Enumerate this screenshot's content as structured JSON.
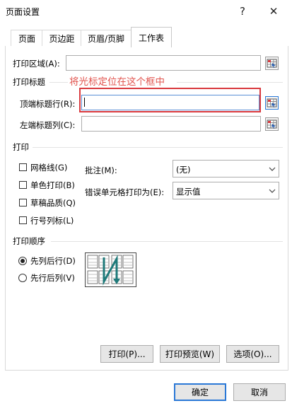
{
  "window": {
    "title": "页面设置",
    "help_icon": "?",
    "close_icon": "✕"
  },
  "tabs": [
    "页面",
    "页边距",
    "页眉/页脚",
    "工作表"
  ],
  "print_area": {
    "label": "打印区域(A):",
    "value": ""
  },
  "print_titles": {
    "section": "打印标题",
    "rows_label": "顶端标题行(R):",
    "rows_value": "",
    "cols_label": "左端标题列(C):",
    "cols_value": ""
  },
  "annotation": {
    "text": "将光标定位在这个框中",
    "color": "#e2554f"
  },
  "print": {
    "section": "打印",
    "checkboxes": [
      "网格线(G)",
      "单色打印(B)",
      "草稿品质(Q)",
      "行号列标(L)"
    ],
    "comments_label": "批注(M):",
    "comments_value": "(无)",
    "errors_label": "错误单元格打印为(E):",
    "errors_value": "显示值"
  },
  "page_order": {
    "section": "打印顺序",
    "options": [
      "先列后行(D)",
      "先行后列(V)"
    ],
    "selected": 0
  },
  "panel_buttons": {
    "print": "打印(P)...",
    "preview": "打印预览(W)",
    "options": "选项(O)..."
  },
  "dialog_buttons": {
    "ok": "确定",
    "cancel": "取消"
  },
  "colors": {
    "accent": "#2a78d6",
    "annotation_border": "#d9393e",
    "arrow": "#1f7a7a"
  }
}
